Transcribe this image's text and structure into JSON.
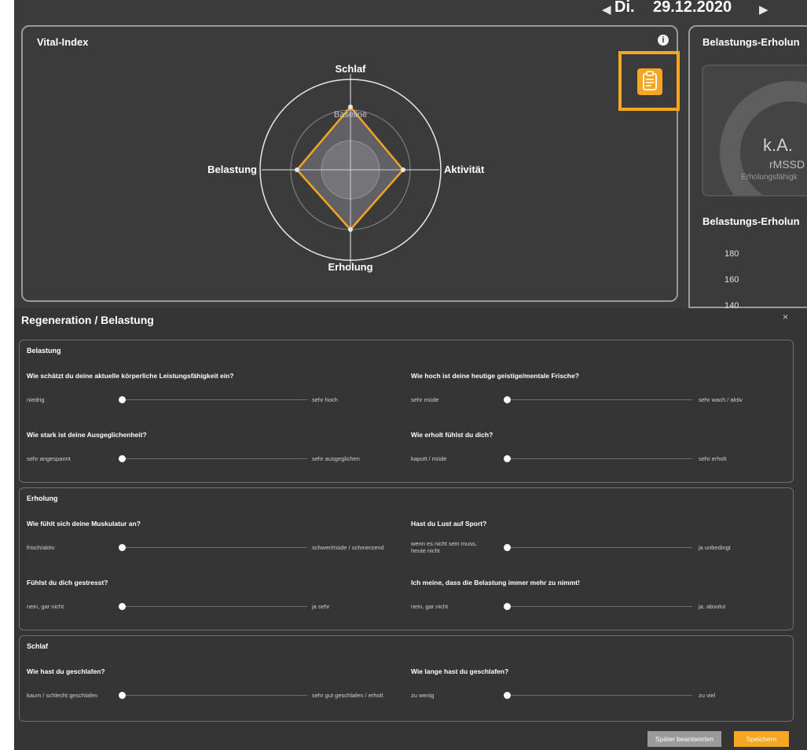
{
  "date": {
    "day": "Di.",
    "value": "29.12.2020"
  },
  "vital": {
    "title": "Vital-Index",
    "axes": {
      "top": "Schlaf",
      "right": "Aktivität",
      "bottom": "Erholung",
      "left": "Belastung"
    },
    "baseline_label": "Baseline",
    "accent": "#f5a623"
  },
  "right_panel": {
    "title": "Belastungs-Erholun",
    "gauge_value": "k.A.",
    "gauge_metric": "rMSSD",
    "gauge_sub": "Erholungsfähigk",
    "title2": "Belastungs-Erholun",
    "ticks": [
      "180",
      "160",
      "140"
    ]
  },
  "modal": {
    "title": "Regeneration / Belastung",
    "close": "×",
    "sections": [
      {
        "title": "Belastung",
        "questions": [
          {
            "text": "Wie schätzt du deine aktuelle körperliche Leistungsfähigkeit ein?",
            "min": "niedrig",
            "max": "sehr hoch",
            "value": 0
          },
          {
            "text": "Wie hoch ist deine heutige geistige/mentale Frische?",
            "min": "sehr müde",
            "max": "sehr wach / aktiv",
            "value": 0
          },
          {
            "text": "Wie stark ist deine Ausgeglichenheit?",
            "min": "sehr angespannt",
            "max": "sehr ausgeglichen",
            "value": 0
          },
          {
            "text": "Wie erholt fühlst du dich?",
            "min": "kaputt / müde",
            "max": "sehr erholt",
            "value": 0
          }
        ]
      },
      {
        "title": "Erholung",
        "questions": [
          {
            "text": "Wie fühlt sich deine Muskulatur an?",
            "min": "frisch/aktiv",
            "max": "schwer/müde / schmerzend",
            "value": 0
          },
          {
            "text": "Hast du Lust auf Sport?",
            "min": "wenn es nicht sein muss, heute nicht",
            "max": "ja unbedingt",
            "value": 0
          },
          {
            "text": "Fühlst du dich gestresst?",
            "min": "nein, gar nicht",
            "max": "ja sehr",
            "value": 0
          },
          {
            "text": "Ich meine, dass die Belastung immer mehr zu nimmt!",
            "min": "nein, gar nicht",
            "max": "ja, absolut",
            "value": 0
          }
        ]
      },
      {
        "title": "Schlaf",
        "questions": [
          {
            "text": "Wie hast du geschlafen?",
            "min": "kaum / schlecht geschlafen",
            "max": "sehr gut geschlafen / erholt",
            "value": 0
          },
          {
            "text": "Wie lange hast du geschlafen?",
            "min": "zu wenig",
            "max": "zu viel",
            "value": 0
          }
        ]
      }
    ],
    "buttons": {
      "later": "Später beantworten",
      "save": "Speichern"
    }
  }
}
